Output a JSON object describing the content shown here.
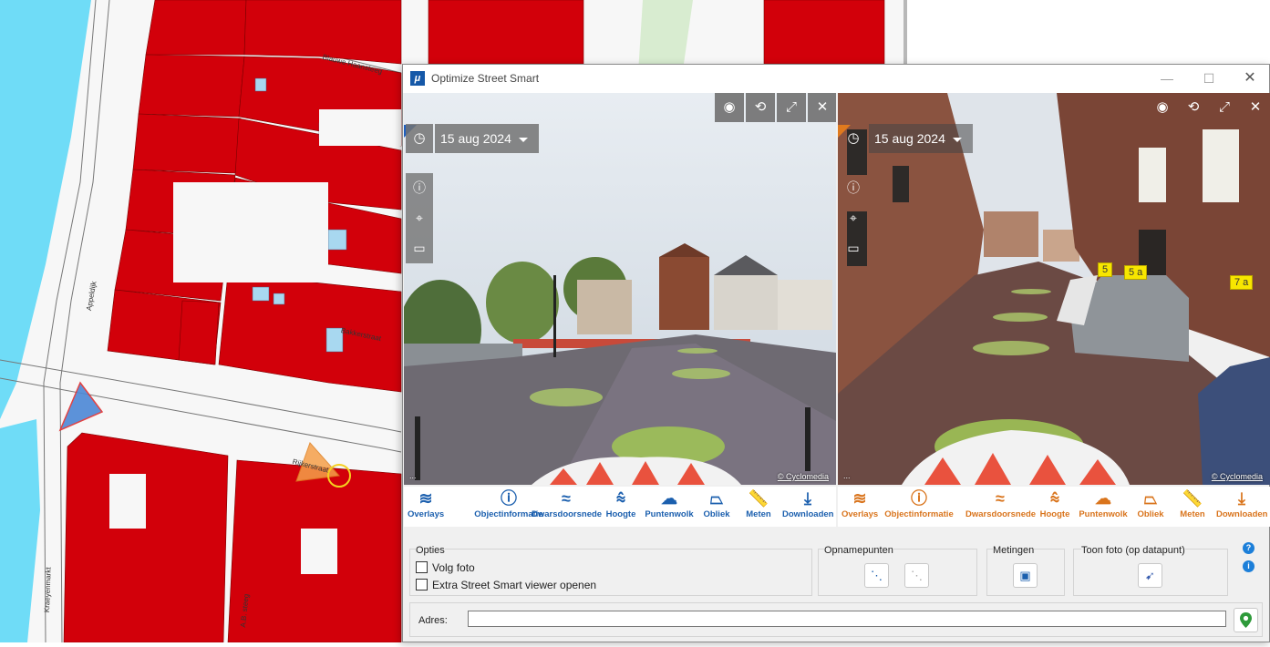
{
  "map": {
    "street_labels": {
      "blauwe_haansteeg": "Blauwe Haansteeg",
      "appeldijk": "Appeldijk",
      "bakkerstraat": "Bakkerstraat",
      "rijnkerstraat": "Rijkerstraat",
      "kraeyenmarkt": "Kraeyenmarkt",
      "a_b_steeg": "A.B. steeg"
    },
    "colors": {
      "water": "#6fdcf7",
      "buildings": "#d2000a",
      "road": "#f7f7f7",
      "park": "#d8ecd0"
    }
  },
  "window": {
    "title": "Optimize Street Smart",
    "app_icon": "Optimize logo",
    "controls": {
      "minimize": "—",
      "maximize": "☐",
      "close": "✕"
    }
  },
  "panorama_left": {
    "date": "15 aug 2024",
    "credit": "© Cyclomedia",
    "info": "...",
    "icons": [
      "eye-icon",
      "rotate-icon",
      "expand-icon",
      "close-icon"
    ]
  },
  "panorama_right": {
    "date": "15 aug 2024",
    "credit": "© Cyclomedia",
    "info": "...",
    "house_numbers": [
      "5",
      "5 a",
      "7 a"
    ]
  },
  "toolbar_left": {
    "accent": "#1b5fae",
    "items": [
      "Overlays",
      "Objectinformatie",
      "Dwarsdoorsnede",
      "Hoogte",
      "Puntenwolk",
      "Obliek",
      "Meten",
      "Downloaden"
    ]
  },
  "toolbar_right": {
    "accent": "#d9741c",
    "items": [
      "Overlays",
      "Objectinformatie",
      "Dwarsdoorsnede",
      "Hoogte",
      "Puntenwolk",
      "Obliek",
      "Meten",
      "Downloaden"
    ]
  },
  "options": {
    "title": "Opties",
    "follow_photo": {
      "label": "Volg foto",
      "checked": false
    },
    "extra_viewer": {
      "label": "Extra Street Smart viewer openen",
      "checked": false
    }
  },
  "opnamepunten": {
    "title": "Opnamepunten"
  },
  "metingen": {
    "title": "Metingen"
  },
  "toon_foto": {
    "title": "Toon foto (op datapunt)"
  },
  "address": {
    "label": "Adres:",
    "value": ""
  }
}
